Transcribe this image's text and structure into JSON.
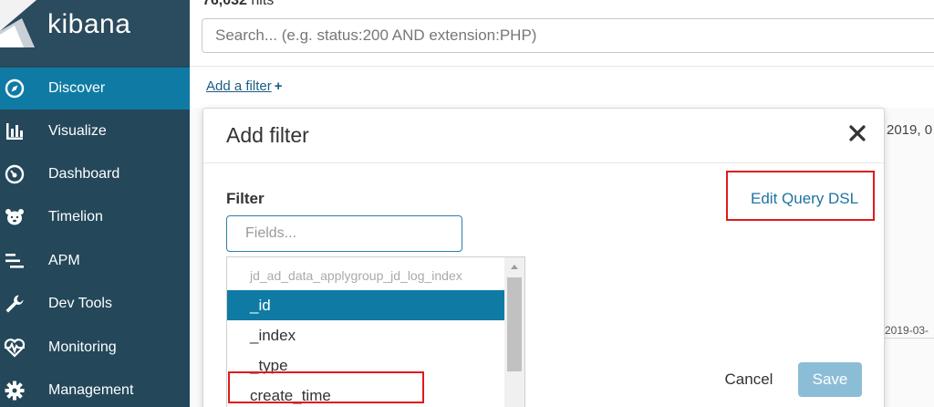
{
  "app": {
    "logo_text": "kibana",
    "colors": {
      "sidebar": "#24475a",
      "active_nav": "#0f7ba4",
      "accent_link": "#1f72a3",
      "highlight_box": "#e01a1a"
    }
  },
  "sidebar": {
    "items": [
      {
        "label": "Discover",
        "icon": "compass-icon",
        "active": true
      },
      {
        "label": "Visualize",
        "icon": "bar-chart-icon",
        "active": false
      },
      {
        "label": "Dashboard",
        "icon": "gauge-icon",
        "active": false
      },
      {
        "label": "Timelion",
        "icon": "bear-icon",
        "active": false
      },
      {
        "label": "APM",
        "icon": "apm-lines-icon",
        "active": false
      },
      {
        "label": "Dev Tools",
        "icon": "wrench-icon",
        "active": false
      },
      {
        "label": "Monitoring",
        "icon": "heartbeat-icon",
        "active": false
      },
      {
        "label": "Management",
        "icon": "gear-icon",
        "active": false
      }
    ]
  },
  "header": {
    "hits_count": "76,032",
    "hits_label": "hits",
    "search_placeholder": "Search... (e.g. status:200 AND extension:PHP)",
    "add_filter_label": "Add a filter",
    "add_filter_plus": "+"
  },
  "background": {
    "date_text_top": "2019, 0",
    "date_text_axis": "2019-03-"
  },
  "modal": {
    "title": "Add filter",
    "filter_label": "Filter",
    "edit_dsl_label": "Edit Query DSL",
    "fields_placeholder": "Fields...",
    "dropdown": {
      "group_label": "jd_ad_data_applygroup_jd_log_index",
      "items": [
        "_id",
        "_index",
        "_type",
        "create_time"
      ],
      "selected": "_id"
    },
    "cancel_label": "Cancel",
    "save_label": "Save"
  }
}
